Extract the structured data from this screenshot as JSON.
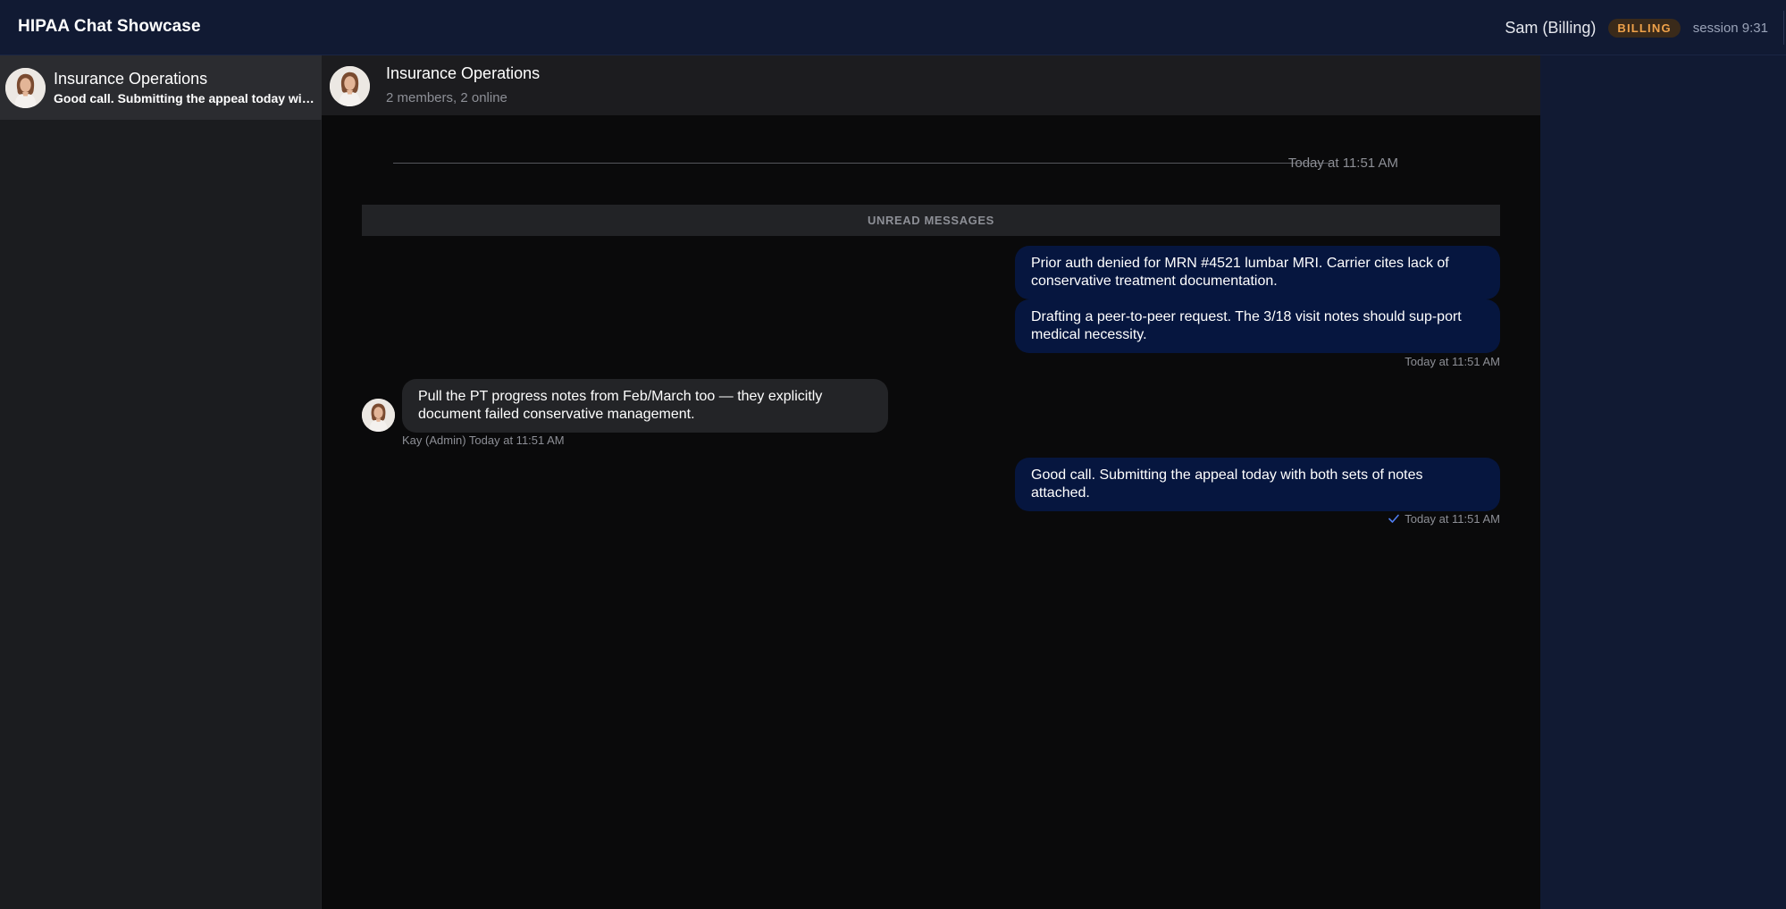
{
  "app": {
    "title": "HIPAA Chat Showcase"
  },
  "user": {
    "name": "Sam (Billing)",
    "role_badge": "BILLING",
    "session": "session 9:31"
  },
  "sidebar": {
    "conversations": [
      {
        "name": "Insurance Operations",
        "preview": "Good call. Submitting the appeal today with both sets of notes attached.",
        "avatar_icon": "avatar-photo"
      }
    ]
  },
  "chat": {
    "title": "Insurance Operations",
    "subtitle": "2 members, 2 online",
    "date_divider": "Today at 11:51 AM",
    "unread_label": "UNREAD MESSAGES",
    "messages": [
      {
        "direction": "outgoing",
        "text": "Prior auth denied for MRN #4521 lumbar MRI. Carrier cites lack of conservative treatment documentation."
      },
      {
        "direction": "outgoing",
        "text": "Drafting a peer-to-peer request. The 3/18 visit notes should sup-port medical necessity.",
        "timestamp": "Today at 11:51 AM"
      },
      {
        "direction": "incoming",
        "text": "Pull the PT progress notes from Feb/March too — they explicitly document failed conservative management.",
        "sender": "Kay (Admin)",
        "timestamp": "Today at 11:51 AM"
      },
      {
        "direction": "outgoing",
        "text": "Good call. Submitting the appeal today with both sets of notes attached.",
        "timestamp": "Today at 11:51 AM",
        "status_icon": "check-icon"
      }
    ]
  },
  "colors": {
    "topbar": "#111a33",
    "outgoing_bubble": "#06163f",
    "incoming_bubble": "#232427",
    "badge_text": "#f0a24a",
    "read_check": "#4f7df0"
  }
}
